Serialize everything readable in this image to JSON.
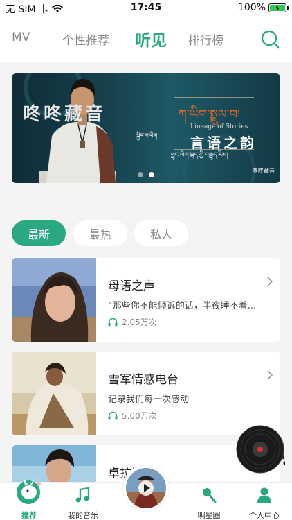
{
  "status_bar": {
    "carrier": "无 SIM 卡",
    "time": "17:45",
    "battery": "100%"
  },
  "top_nav": {
    "tabs": [
      {
        "label": "MV"
      },
      {
        "label": "个性推荐"
      },
      {
        "label": "听见"
      },
      {
        "label": "排行榜"
      }
    ],
    "active_tab": "听见"
  },
  "banner": {
    "left_brand": "咚咚藏音",
    "title_tibetan": "ཀ་ཡིག་སྤྲུལ་བ།",
    "title_en": "Lineage of Stories",
    "title_zh": "言语之韵",
    "subtitle_tibetan": "ཕྱུང་ཡིག་སྐད་ཀྱི་བརྒྱུད་རིམ།",
    "side_tibetan": "སྐྱིད་ལ་ཡིག",
    "brand_small": "咚咚藏音",
    "slide_count": 2,
    "active_slide": 2
  },
  "filters": [
    {
      "label": "最新"
    },
    {
      "label": "最热"
    },
    {
      "label": "私人"
    }
  ],
  "active_filter": "最新",
  "cards": [
    {
      "title": "母语之声",
      "description": "“那些你不能倾诉的话，半夜睡不着...",
      "plays": "2.05万次"
    },
    {
      "title": "雪军情感电台",
      "description": "记录我们每一次感动",
      "plays": "5.00万次"
    },
    {
      "title": "卓拉巴",
      "description": "",
      "plays": ""
    }
  ],
  "bottom_tabs": [
    {
      "label": "推荐"
    },
    {
      "label": "我的音乐"
    },
    {
      "label": ""
    },
    {
      "label": "明星圈"
    },
    {
      "label": "个人中心"
    }
  ],
  "colors": {
    "accent": "#2aa882",
    "background": "#f4f4f4",
    "banner_bg": "#16414c",
    "tab_inactive": "#8a8a8a"
  }
}
